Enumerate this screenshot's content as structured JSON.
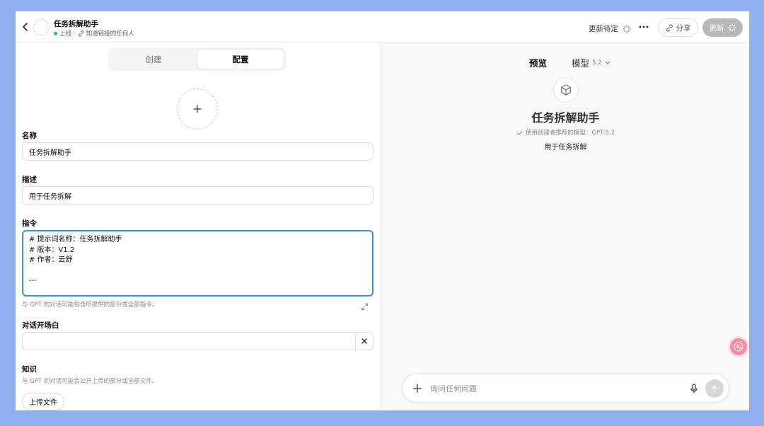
{
  "header": {
    "gpt_name": "任务拆解助手",
    "status": "上线",
    "separator": "·",
    "visibility": "知道链接的任何人",
    "pending": "更新待定",
    "share": "分享",
    "update": "更新"
  },
  "editor": {
    "tabs": [
      "创建",
      "配置"
    ],
    "name_label": "名称",
    "name_value": "任务拆解助手",
    "desc_label": "描述",
    "desc_value": "用于任务拆解",
    "instructions_label": "指令",
    "instructions_lines": [
      "# 提示词名称：任务拆解助手",
      "# 版本：V1.2",
      "# 作者：云舒",
      "",
      "---"
    ],
    "instructions_hint": "与 GPT 的对话可能包含所提供的部分或全部指令。",
    "starters_label": "对话开场白",
    "starters_value": "",
    "knowledge_label": "知识",
    "knowledge_hint": "与 GPT 的对话可能会公开上传的部分或全部文件。",
    "upload": "上传文件"
  },
  "preview": {
    "label": "预览",
    "model_label": "模型",
    "model_version": "5.2",
    "title": "任务拆解助手",
    "model_note": "使用创建者推荐的模型：GPT-5.2",
    "description": "用于任务拆解",
    "composer_placeholder": "询问任何问题"
  }
}
